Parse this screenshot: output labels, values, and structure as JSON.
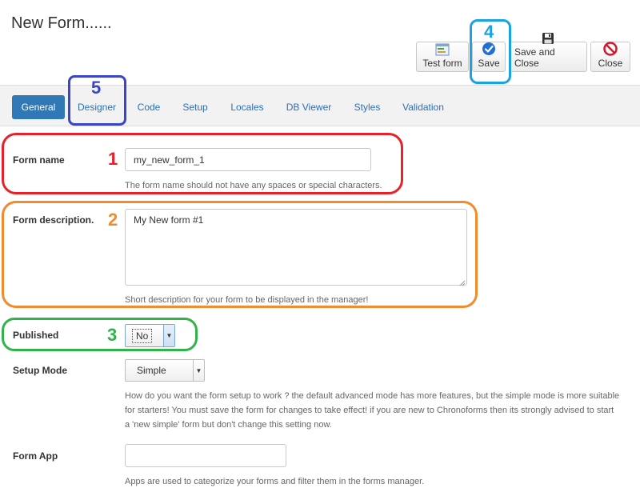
{
  "page": {
    "title": "New Form......"
  },
  "toolbar": {
    "test_form": "Test form",
    "save": "Save",
    "save_and_close": "Save and Close",
    "close": "Close"
  },
  "tabs": [
    {
      "label": "General",
      "active": true
    },
    {
      "label": "Designer",
      "active": false
    },
    {
      "label": "Code",
      "active": false
    },
    {
      "label": "Setup",
      "active": false
    },
    {
      "label": "Locales",
      "active": false
    },
    {
      "label": "DB Viewer",
      "active": false
    },
    {
      "label": "Styles",
      "active": false
    },
    {
      "label": "Validation",
      "active": false
    }
  ],
  "form": {
    "form_name": {
      "label": "Form name",
      "value": "my_new_form_1",
      "help": "The form name should not have any spaces or special characters."
    },
    "form_description": {
      "label": "Form description.",
      "value": "My New form #1",
      "help": "Short description for your form to be displayed in the manager!"
    },
    "published": {
      "label": "Published",
      "value": "No"
    },
    "setup_mode": {
      "label": "Setup Mode",
      "value": "Simple",
      "help": "How do you want the form setup to work ? the default advanced mode has more features, but the simple mode is more suitable for starters! You must save the form for changes to take effect! if you are new to Chronoforms then its strongly advised to start a 'new simple' form but don't change this setting now."
    },
    "form_app": {
      "label": "Form App",
      "value": "",
      "help": "Apps are used to categorize your forms and filter them in the forms manager."
    }
  },
  "annotations": [
    {
      "number": "1",
      "color": "#e8202a"
    },
    {
      "number": "2",
      "color": "#f28a2e"
    },
    {
      "number": "3",
      "color": "#2fb34a"
    },
    {
      "number": "4",
      "color": "#1aa3e0"
    },
    {
      "number": "5",
      "color": "#3a46c4"
    }
  ],
  "icons": {
    "test_form": "form-test-icon",
    "save": "check-circle-icon",
    "save_and_close": "floppy-disk-icon",
    "close": "no-entry-icon"
  }
}
